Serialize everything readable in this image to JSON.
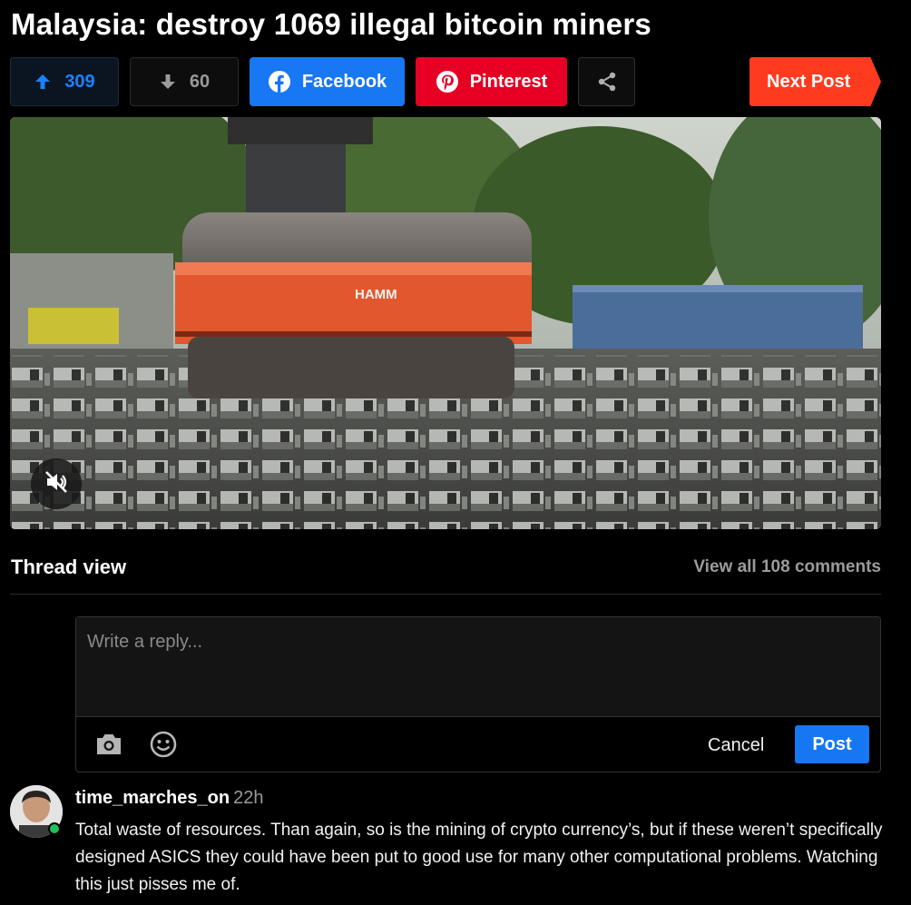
{
  "post": {
    "title": "Malaysia: destroy 1069 illegal bitcoin miners"
  },
  "actions": {
    "upvotes": "309",
    "downvotes": "60",
    "facebook_label": "Facebook",
    "pinterest_label": "Pinterest",
    "next_post_label": "Next Post"
  },
  "media": {
    "roller_brand": "HAMM"
  },
  "thread": {
    "title": "Thread view",
    "view_all": "View all 108 comments"
  },
  "reply": {
    "placeholder": "Write a reply...",
    "cancel_label": "Cancel",
    "post_label": "Post"
  },
  "comments": [
    {
      "username": "time_marches_on",
      "time": "22h",
      "text": "Total waste of resources. Than again, so is the mining of crypto currency’s, but if these weren’t specifically designed ASICS they could have been put to good use for many other computational problems. Watching this just pisses me of."
    }
  ],
  "colors": {
    "upvote": "#1a82ff",
    "facebook": "#1877f2",
    "pinterest": "#e60023",
    "next_post": "#ff3b1f",
    "post_button": "#1677f2",
    "online": "#21c05a"
  }
}
